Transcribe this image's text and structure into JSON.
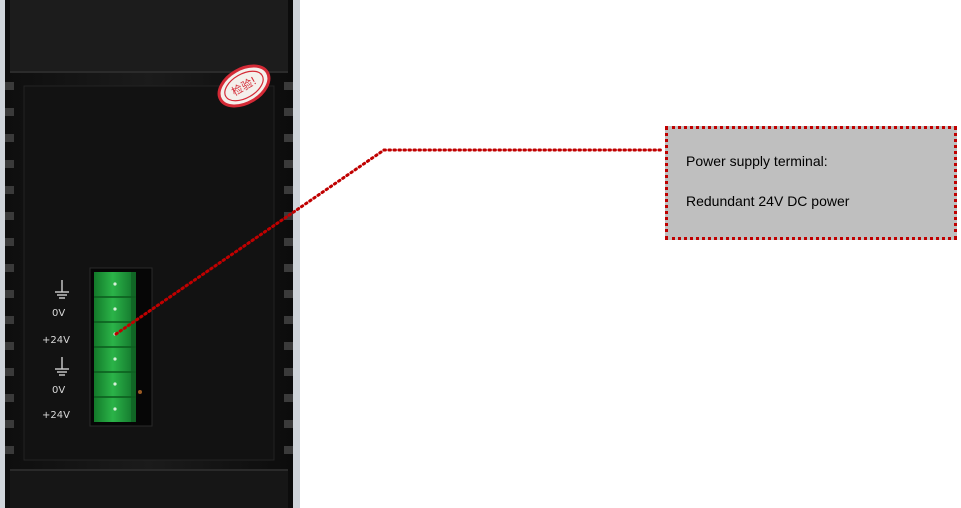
{
  "photo": {
    "subject": "din-rail-power-module",
    "sticker_text": "检验!",
    "sticker_color": "#d42a36",
    "terminal_labels": [
      "0V",
      "+24V",
      "0V",
      "+24V"
    ],
    "terminal_ground_icon": "ground-icon",
    "connector_color": "#1e9a36"
  },
  "callout": {
    "line1": "Power supply terminal:",
    "line2": "Redundant 24V DC power",
    "box_color": "#bfbfbf",
    "border_color": "#c00000"
  }
}
